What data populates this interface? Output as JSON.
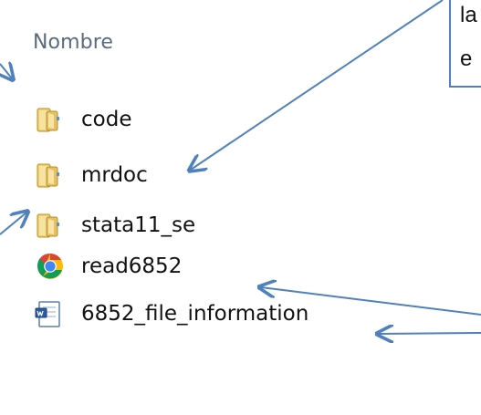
{
  "header": {
    "name_label": "Nombre"
  },
  "files": [
    {
      "name": "code",
      "icon": "folder-icon"
    },
    {
      "name": "mrdoc",
      "icon": "folder-icon"
    },
    {
      "name": "stata11_se",
      "icon": "folder-icon"
    },
    {
      "name": "read6852",
      "icon": "chrome-icon"
    },
    {
      "name": "6852_file_information",
      "icon": "word-document-icon"
    }
  ],
  "callout": {
    "line1": "la",
    "line2": "e"
  },
  "colors": {
    "arrow": "#4f81bd",
    "header_text": "#5b6b7f",
    "folder_yellow": "#e9c75a"
  }
}
